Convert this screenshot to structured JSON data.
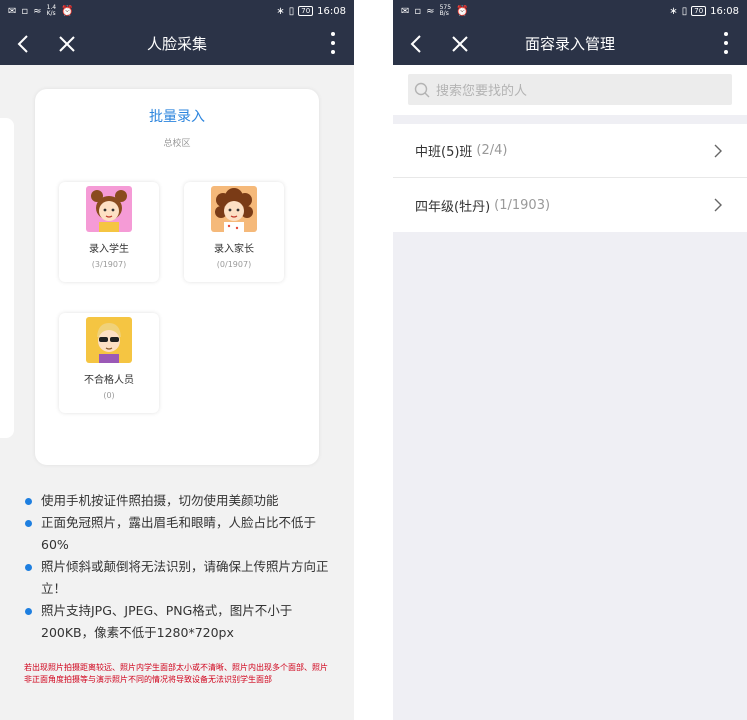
{
  "left_screen": {
    "status_bar": {
      "speed_top": "1.4",
      "speed_bottom": "K/s",
      "battery": "70",
      "time": "16:08"
    },
    "nav": {
      "title": "人脸采集"
    },
    "card": {
      "title": "批量录入",
      "subtitle": "总校区",
      "tiles": [
        {
          "label": "录入学生",
          "count": "(3/1907)"
        },
        {
          "label": "录入家长",
          "count": "(0/1907)"
        },
        {
          "label": "不合格人员",
          "count": "(0)"
        }
      ]
    },
    "tips": [
      "使用手机按证件照拍摄，切勿使用美颜功能",
      "正面免冠照片，露出眉毛和眼睛，人脸占比不低于60%",
      "照片倾斜或颠倒将无法识别，请确保上传照片方向正立！",
      "照片支持JPG、JPEG、PNG格式，图片不小于200KB，像素不低于1280*720px"
    ],
    "warning": "若出现照片拍摄距离较远、照片内学生面部太小或不清晰、照片内出现多个面部、照片非正面角度拍摄等与演示照片不同的情况将导致设备无法识别学生面部"
  },
  "right_screen": {
    "status_bar": {
      "speed_top": "575",
      "speed_bottom": "B/s",
      "battery": "70",
      "time": "16:08"
    },
    "nav": {
      "title": "面容录入管理"
    },
    "search": {
      "placeholder": "搜索您要找的人"
    },
    "list": [
      {
        "name": "中班(5)班",
        "count": "(2/4)"
      },
      {
        "name": "四年级(牡丹)",
        "count": "(1/1903)"
      }
    ]
  },
  "colors": {
    "nav_bg": "#2b3347",
    "accent_blue": "#2e86de",
    "warning_red": "#d0021b"
  }
}
